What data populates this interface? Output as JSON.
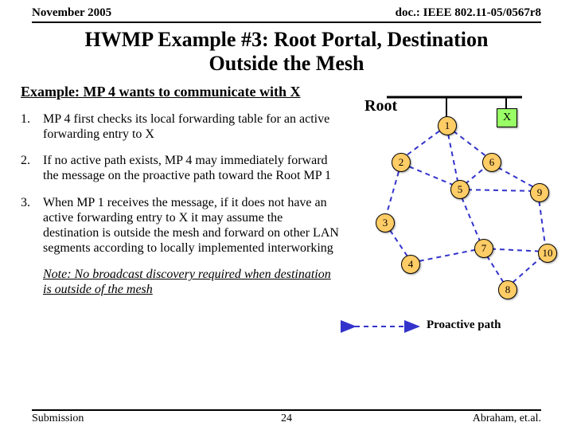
{
  "header": {
    "date": "November 2005",
    "doc": "doc.: IEEE 802.11-05/0567r8"
  },
  "title_line1": "HWMP Example #3: Root Portal, Destination",
  "title_line2": "Outside the Mesh",
  "example_heading": "Example: MP 4 wants to communicate with X",
  "items": [
    {
      "n": "1.",
      "text": "MP 4 first checks its local forwarding table for an active forwarding entry to X"
    },
    {
      "n": "2.",
      "text": "If no active path exists, MP 4 may immediately forward the message on the proactive path toward the Root MP 1"
    },
    {
      "n": "3.",
      "text": "When MP 1 receives the message, if it does not have an active forwarding entry to X it may assume the destination is outside the mesh and forward on other LAN segments according to locally implemented interworking"
    }
  ],
  "note": "Note: No broadcast discovery required when destination is outside of the mesh",
  "diagram": {
    "root_label": "Root",
    "x_label": "X",
    "legend": "Proactive path",
    "nodes": {
      "n1": "1",
      "n2": "2",
      "n3": "3",
      "n4": "4",
      "n5": "5",
      "n6": "6",
      "n7": "7",
      "n8": "8",
      "n9": "9",
      "n10": "10"
    }
  },
  "footer": {
    "left": "Submission",
    "page": "24",
    "right": "Abraham, et.al."
  }
}
